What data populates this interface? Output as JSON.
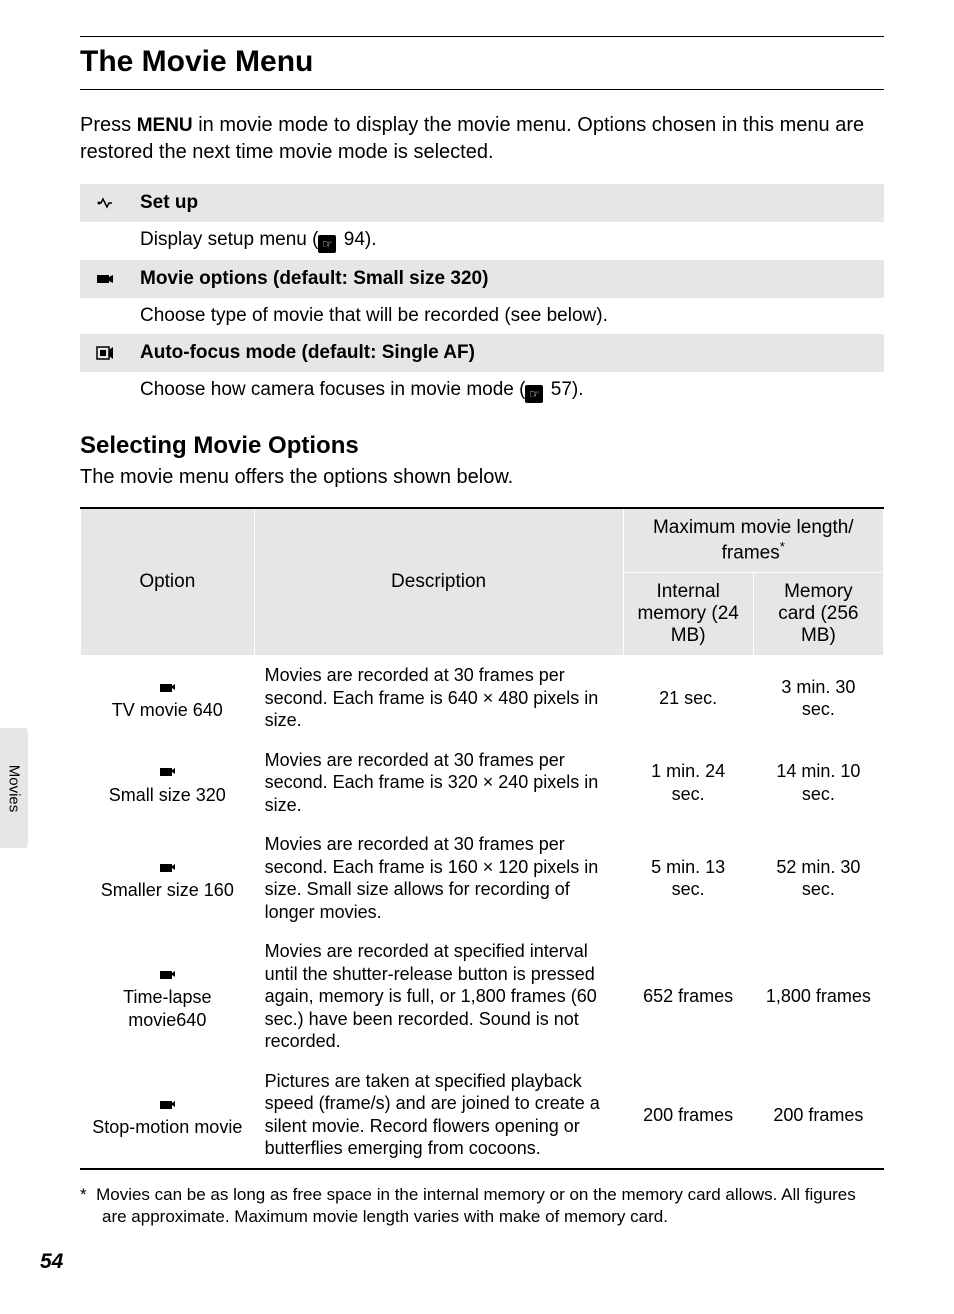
{
  "page_title": "The Movie Menu",
  "intro_before_menu": "Press ",
  "menu_label": "MENU",
  "intro_after_menu": " in movie mode to display the movie menu. Options chosen in this menu are restored the next time movie mode is selected.",
  "menu_items": [
    {
      "title": "Set up",
      "desc_before": "Display setup menu (",
      "desc_page": " 94).",
      "has_book_icon": true,
      "icon_kind": "setup"
    },
    {
      "title": "Movie options (default: Small size 320)",
      "desc_before": "Choose type of movie that will be recorded (see below).",
      "desc_page": "",
      "has_book_icon": false,
      "icon_kind": "movie"
    },
    {
      "title": "Auto-focus mode (default: Single AF)",
      "desc_before": "Choose how camera focuses in movie mode (",
      "desc_page": " 57).",
      "has_book_icon": true,
      "icon_kind": "af"
    }
  ],
  "sub_heading": "Selecting Movie Options",
  "sub_intro": "The movie menu offers the options shown below.",
  "table": {
    "headers": {
      "option": "Option",
      "description": "Description",
      "maxlen": "Maximum movie length/\nframes",
      "star": "*",
      "internal": "Internal memory (24 MB)",
      "card": "Memory card (256 MB)"
    },
    "rows": [
      {
        "option": "TV movie 640",
        "desc": "Movies are recorded at 30 frames per second. Each frame is 640 × 480 pixels in size.",
        "internal": "21 sec.",
        "card": "3 min. 30 sec."
      },
      {
        "option": "Small size 320",
        "desc": "Movies are recorded at 30 frames per second. Each frame is 320 × 240 pixels in size.",
        "internal": "1 min. 24 sec.",
        "card": "14 min. 10 sec."
      },
      {
        "option": "Smaller size 160",
        "desc": "Movies are recorded at 30 frames per second. Each frame is 160 × 120 pixels in size. Small size allows for recording of longer movies.",
        "internal": "5 min. 13 sec.",
        "card": "52 min. 30 sec."
      },
      {
        "option": "Time-lapse movie640",
        "desc": "Movies are recorded at specified interval until the shutter-release button is pressed again, memory is full, or 1,800 frames (60 sec.) have been recorded. Sound is not recorded.",
        "internal": "652 frames",
        "card": "1,800 frames"
      },
      {
        "option": "Stop-motion movie",
        "desc": "Pictures are taken at specified playback speed (frame/s) and are joined to create a silent movie. Record flowers opening or butterflies emerging from cocoons.",
        "internal": "200 frames",
        "card": "200 frames"
      }
    ]
  },
  "footnote_star": "*",
  "footnote": "Movies can be as long as free space in the internal memory or on the memory card allows. All figures are approximate. Maximum movie length varies with make of memory card.",
  "side_tab": "Movies",
  "page_number": "54"
}
